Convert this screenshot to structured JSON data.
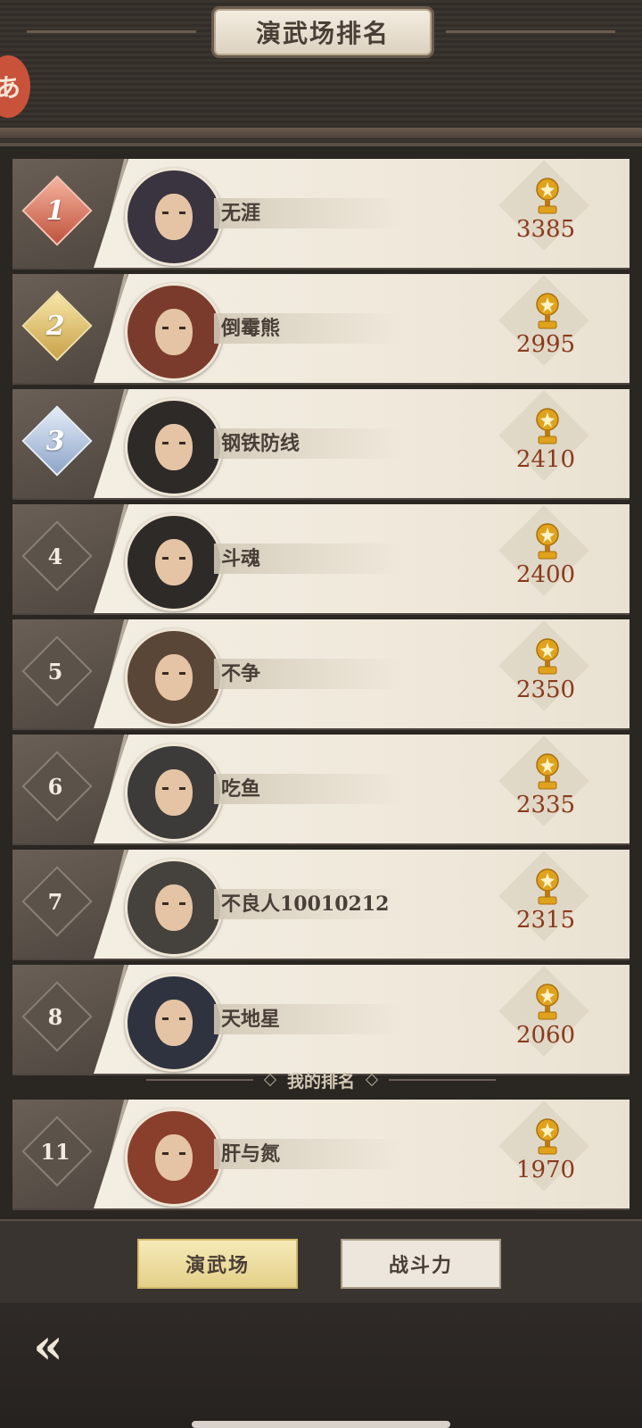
{
  "header": {
    "title": "演武场排名"
  },
  "rankings": [
    {
      "rank": "1",
      "name": "无涯",
      "score": "3385",
      "avatar": "hooded-masked-assassin-avatar",
      "avatar_color": "#3a3340"
    },
    {
      "rank": "2",
      "name": "倒霉熊",
      "score": "2995",
      "avatar": "woman-red-headdress-avatar",
      "avatar_color": "#7a3b2c"
    },
    {
      "rank": "3",
      "name": "钢铁防线",
      "score": "2410",
      "avatar": "straw-hat-red-mask-avatar",
      "avatar_color": "#2e2a28"
    },
    {
      "rank": "4",
      "name": "斗魂",
      "score": "2400",
      "avatar": "straw-hat-red-mask-avatar",
      "avatar_color": "#2e2a28"
    },
    {
      "rank": "5",
      "name": "不争",
      "score": "2350",
      "avatar": "woman-dark-hair-avatar",
      "avatar_color": "#5a4636"
    },
    {
      "rank": "6",
      "name": "吃鱼",
      "score": "2335",
      "avatar": "silver-mask-avatar",
      "avatar_color": "#3d3b39"
    },
    {
      "rank": "7",
      "name": "不良人10010212",
      "score": "2315",
      "avatar": "white-opera-mask-avatar",
      "avatar_color": "#45413d"
    },
    {
      "rank": "8",
      "name": "天地星",
      "score": "2060",
      "avatar": "headband-man-avatar",
      "avatar_color": "#2f3340"
    }
  ],
  "my_rank_label": "我的排名",
  "my_rank": {
    "rank": "11",
    "name": "肝与氮",
    "score": "1970",
    "avatar": "bearded-warrior-avatar",
    "avatar_color": "#8a3e2c"
  },
  "tabs": [
    {
      "label": "演武场",
      "active": true
    },
    {
      "label": "战斗力",
      "active": false
    }
  ],
  "side_emblem": "あ",
  "colors": {
    "score": "#8a3a1c",
    "trophy": "#e0a21c",
    "active_tab": "#f0e2a2"
  }
}
